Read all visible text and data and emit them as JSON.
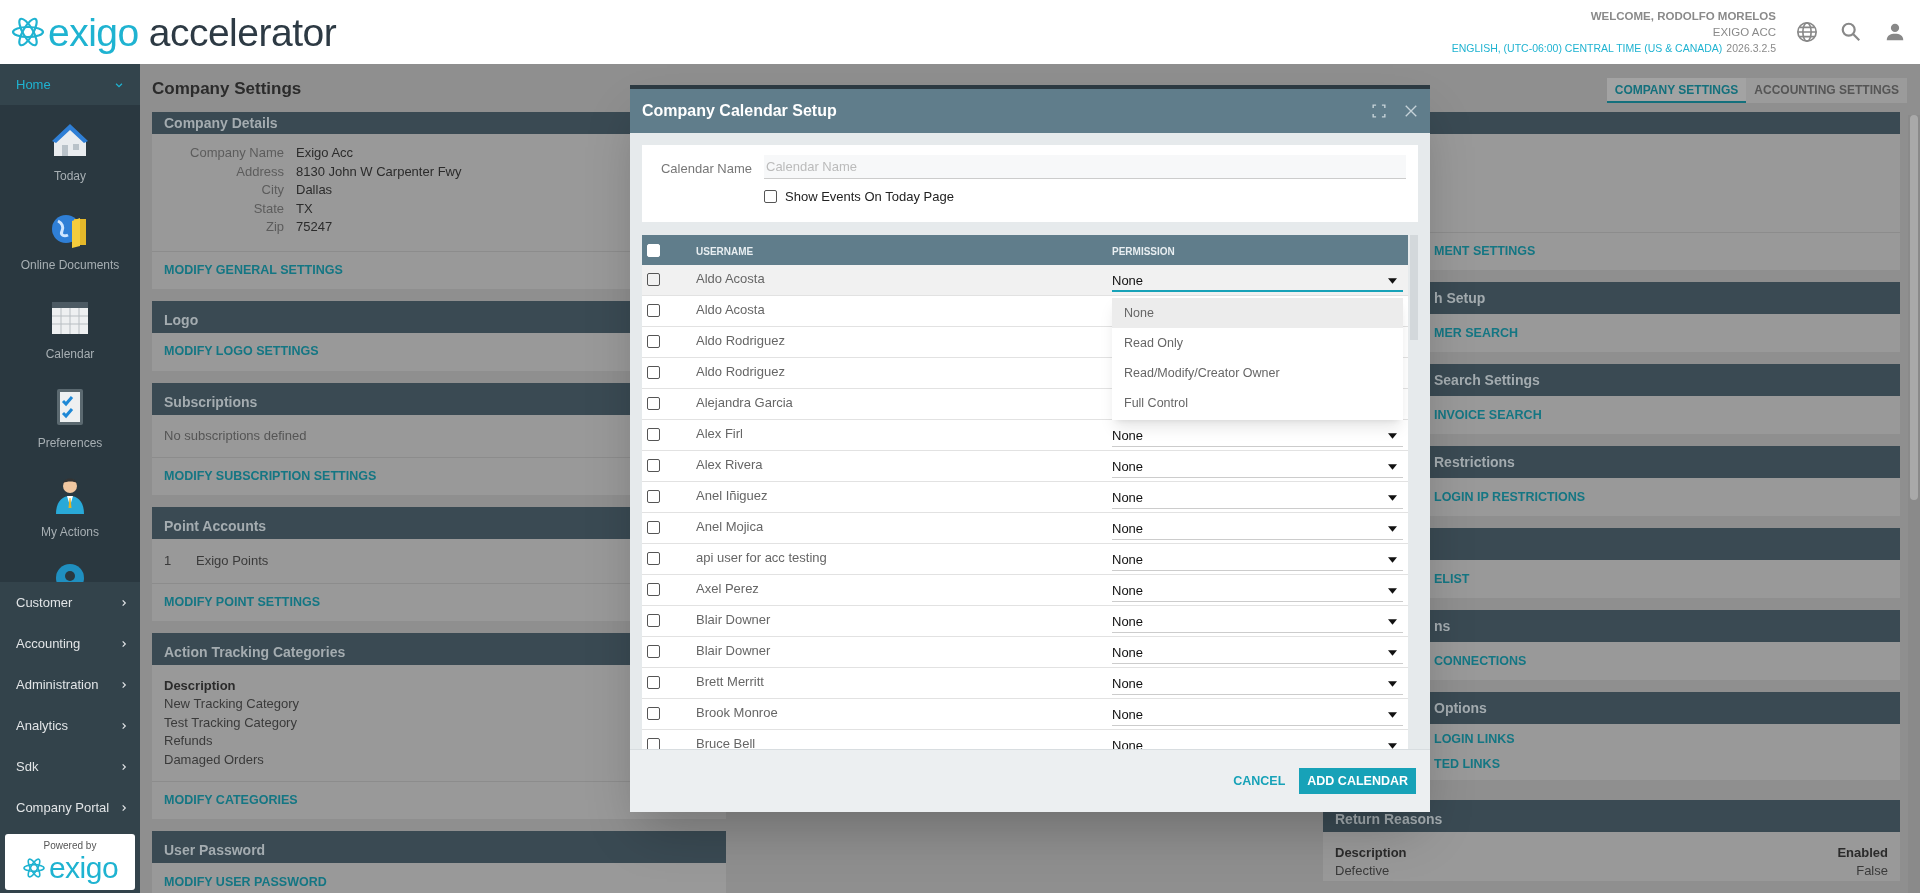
{
  "header": {
    "logo": {
      "brand": "exigo",
      "product": "accelerator"
    },
    "welcome": "WELCOME, RODOLFO MORELOS",
    "company": "EXIGO ACC",
    "locale": "ENGLISH, (UTC-06:00) CENTRAL TIME (US & CANADA)",
    "version": "2026.3.2.5"
  },
  "sidebar": {
    "home": {
      "label": "Home",
      "expanded": true
    },
    "shortcuts": [
      {
        "label": "Today",
        "kind": "house"
      },
      {
        "label": "Online Documents",
        "kind": "globe-folder"
      },
      {
        "label": "Calendar",
        "kind": "calendar"
      },
      {
        "label": "Preferences",
        "kind": "checklist"
      },
      {
        "label": "My Actions",
        "kind": "person"
      }
    ],
    "menu": [
      {
        "label": "Customer"
      },
      {
        "label": "Accounting"
      },
      {
        "label": "Administration"
      },
      {
        "label": "Analytics"
      },
      {
        "label": "Sdk"
      },
      {
        "label": "Company Portal"
      }
    ],
    "powered_by": {
      "caption": "Powered by",
      "brand": "exigo"
    }
  },
  "page": {
    "title": "Company Settings",
    "tabs": [
      {
        "label": "COMPANY SETTINGS",
        "selected": true
      },
      {
        "label": "ACCOUNTING SETTINGS",
        "selected": false
      }
    ]
  },
  "left_panels": [
    {
      "title": "Company Details",
      "fields": [
        {
          "label": "Company Name",
          "value": "Exigo Acc"
        },
        {
          "label": "Address",
          "value": "8130 John W Carpenter Fwy"
        },
        {
          "label": "City",
          "value": "Dallas"
        },
        {
          "label": "State",
          "value": "TX"
        },
        {
          "label": "Zip",
          "value": "75247"
        }
      ],
      "links": [
        "MODIFY GENERAL SETTINGS"
      ]
    },
    {
      "title": "Logo",
      "links": [
        "MODIFY LOGO SETTINGS"
      ]
    },
    {
      "title": "Subscriptions",
      "note": "No subscriptions defined",
      "links": [
        "MODIFY SUBSCRIPTION SETTINGS"
      ]
    },
    {
      "title": "Point Accounts",
      "points": [
        {
          "number": "1",
          "name": "Exigo Points"
        }
      ],
      "links": [
        "MODIFY POINT SETTINGS"
      ]
    },
    {
      "title": "Action Tracking Categories",
      "list": {
        "heading": "Description",
        "items": [
          "New Tracking Category",
          "Test Tracking Category",
          "Refunds",
          "Damaged Orders"
        ]
      },
      "links": [
        "MODIFY CATEGORIES"
      ]
    },
    {
      "title": "User Password",
      "links": [
        "MODIFY USER PASSWORD"
      ]
    }
  ],
  "right_panels": [
    {
      "links": [
        "MENT SETTINGS"
      ]
    },
    {
      "title": "h Setup",
      "links": [
        "MER SEARCH"
      ]
    },
    {
      "title": "Search Settings",
      "links": [
        "INVOICE SEARCH"
      ]
    },
    {
      "title": "Restrictions",
      "links": [
        "LOGIN IP RESTRICTIONS"
      ]
    },
    {
      "links": [
        "ELIST"
      ]
    },
    {
      "title": "ns",
      "links": [
        "CONNECTIONS"
      ]
    },
    {
      "title": "Options",
      "links": [
        "LOGIN LINKS",
        "TED LINKS"
      ]
    },
    {
      "title": "Return Reasons",
      "table": {
        "columns": [
          "Description",
          "Enabled"
        ],
        "rows": [
          [
            "Defective",
            "False"
          ]
        ]
      }
    }
  ],
  "modal": {
    "title": "Company Calendar Setup",
    "name_field": {
      "label": "Calendar Name",
      "placeholder": "Calendar Name"
    },
    "show_events": {
      "label": "Show Events On Today Page",
      "checked": false
    },
    "table": {
      "columns": [
        "USERNAME",
        "PERMISSION"
      ],
      "all_checked": false,
      "rows": [
        {
          "username": "Aldo Acosta",
          "checked": false,
          "permission": "None",
          "open": true
        },
        {
          "username": "Aldo Acosta",
          "checked": false,
          "open": false
        },
        {
          "username": "Aldo Rodriguez",
          "checked": false,
          "open": false
        },
        {
          "username": "Aldo Rodriguez",
          "checked": false,
          "open": false
        },
        {
          "username": "Alejandra Garcia",
          "checked": false,
          "open": false
        },
        {
          "username": "Alex Firl",
          "checked": false,
          "permission": "None",
          "open": false
        },
        {
          "username": "Alex Rivera",
          "checked": false,
          "permission": "None",
          "open": false
        },
        {
          "username": "Anel Iñiguez",
          "checked": false,
          "permission": "None",
          "open": false
        },
        {
          "username": "Anel Mojica",
          "checked": false,
          "permission": "None",
          "open": false
        },
        {
          "username": "api user for acc testing",
          "checked": false,
          "permission": "None",
          "open": false
        },
        {
          "username": "Axel Perez",
          "checked": false,
          "permission": "None",
          "open": false
        },
        {
          "username": "Blair Downer",
          "checked": false,
          "permission": "None",
          "open": false
        },
        {
          "username": "Blair Downer",
          "checked": false,
          "permission": "None",
          "open": false
        },
        {
          "username": "Brett Merritt",
          "checked": false,
          "permission": "None",
          "open": false
        },
        {
          "username": "Brook Monroe",
          "checked": false,
          "permission": "None",
          "open": false
        },
        {
          "username": "Bruce Bell",
          "checked": false,
          "permission": "None",
          "open": false
        }
      ]
    },
    "permission_options": [
      {
        "label": "None",
        "selected": true
      },
      {
        "label": "Read Only",
        "selected": false
      },
      {
        "label": "Read/Modify/Creator Owner",
        "selected": false
      },
      {
        "label": "Full Control",
        "selected": false
      }
    ],
    "buttons": {
      "cancel": "CANCEL",
      "submit": "ADD CALENDAR"
    }
  }
}
